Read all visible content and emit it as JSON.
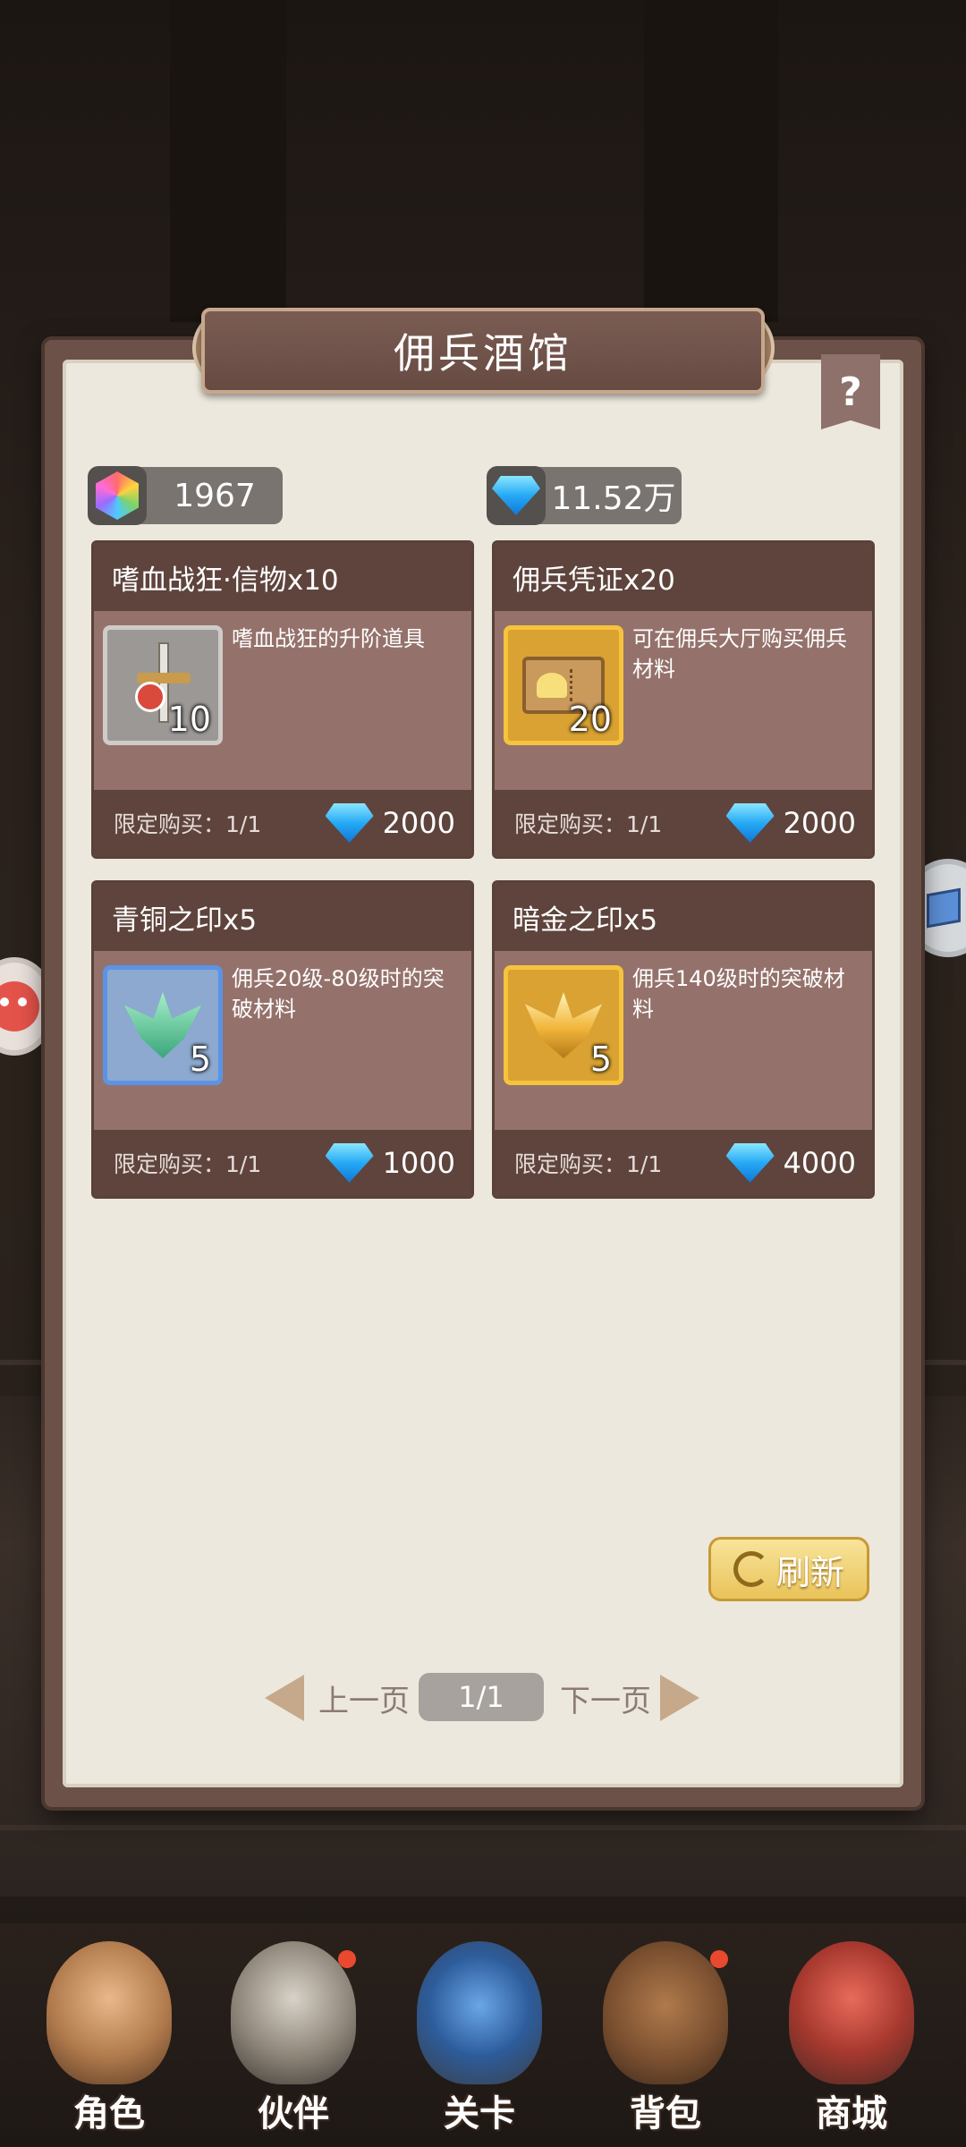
{
  "title": "佣兵酒馆",
  "help_label": "?",
  "currencies": {
    "gems": {
      "icon": "rainbow-gem-icon",
      "value": "1967"
    },
    "diamonds": {
      "icon": "blue-diamond-icon",
      "value": "11.52万"
    }
  },
  "items": [
    {
      "name": "嗜血战狂·信物x10",
      "desc": "嗜血战狂的升阶道具",
      "count": "10",
      "limit": "限定购买：1/1",
      "price": "2000",
      "icon": "sword-token-icon"
    },
    {
      "name": "佣兵凭证x20",
      "desc": "可在佣兵大厅购买佣兵材料",
      "count": "20",
      "limit": "限定购买：1/1",
      "price": "2000",
      "icon": "ticket-icon"
    },
    {
      "name": "青铜之印x5",
      "desc": "佣兵20级-80级时的突破材料",
      "count": "5",
      "limit": "限定购买：1/1",
      "price": "1000",
      "icon": "bronze-seal-icon"
    },
    {
      "name": "暗金之印x5",
      "desc": "佣兵140级时的突破材料",
      "count": "5",
      "limit": "限定购买：1/1",
      "price": "4000",
      "icon": "dark-gold-seal-icon"
    }
  ],
  "refresh_label": "刷新",
  "pagination": {
    "prev": "上一页",
    "page": "1/1",
    "next": "下一页"
  },
  "nav": [
    {
      "label": "角色",
      "icon": "hero-icon"
    },
    {
      "label": "伙伴",
      "icon": "knight-helmet-icon"
    },
    {
      "label": "关卡",
      "icon": "stage-icon"
    },
    {
      "label": "背包",
      "icon": "backpack-icon"
    },
    {
      "label": "商城",
      "icon": "shop-icon"
    }
  ],
  "colors": {
    "diamond": "#26a9f5",
    "accent_gold": "#e9c35a",
    "panel_brown": "#5e443d"
  }
}
